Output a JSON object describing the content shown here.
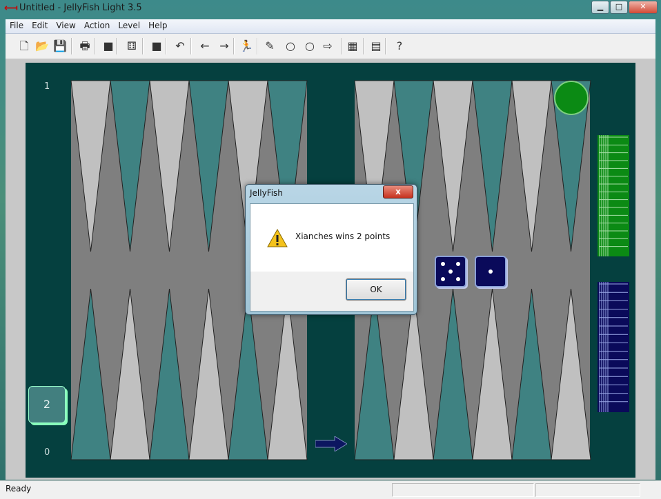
{
  "window": {
    "title": "Untitled - JellyFish Light 3.5",
    "controls": {
      "minimize": "▁",
      "maximize": "□",
      "close": "✕"
    }
  },
  "menu": {
    "items": [
      "File",
      "Edit",
      "View",
      "Action",
      "Level",
      "Help"
    ]
  },
  "toolbar": {
    "buttons": [
      {
        "name": "new-file-icon",
        "glyph": "🗋"
      },
      {
        "name": "open-file-icon",
        "glyph": "📂"
      },
      {
        "name": "save-icon",
        "glyph": "💾"
      },
      {
        "name": "print-icon",
        "glyph": "🖶"
      },
      {
        "name": "stop-icon",
        "glyph": "■"
      },
      {
        "name": "play-icon",
        "glyph": "⚅"
      },
      {
        "name": "stop2-icon",
        "glyph": "■"
      },
      {
        "name": "undo-icon",
        "glyph": "↶"
      },
      {
        "name": "back-icon",
        "glyph": "←"
      },
      {
        "name": "forward-icon",
        "glyph": "→"
      },
      {
        "name": "runner-icon",
        "glyph": "🏃"
      },
      {
        "name": "pencil-icon",
        "glyph": "✎"
      },
      {
        "name": "circle-icon",
        "glyph": "○"
      },
      {
        "name": "circle2-icon",
        "glyph": "○"
      },
      {
        "name": "arrow-right-outline-icon",
        "glyph": "⇨"
      },
      {
        "name": "hint-icon",
        "glyph": "▦"
      },
      {
        "name": "grid-icon",
        "glyph": "▤"
      },
      {
        "name": "help-icon",
        "glyph": "?"
      }
    ]
  },
  "board": {
    "top_label": "1",
    "bottom_label": "0",
    "cube_value": "2",
    "dice": [
      5,
      1
    ]
  },
  "dialog": {
    "title": "JellyFish",
    "close": "x",
    "message": "Xianches wins 2 points",
    "ok_label": "OK"
  },
  "status": {
    "text": "Ready"
  },
  "colors": {
    "board": "#05403f",
    "light_point": "#c0c0c0",
    "teal_point": "#3f8282",
    "checker": "#0b8a14",
    "dice": "#0a0a5a"
  }
}
